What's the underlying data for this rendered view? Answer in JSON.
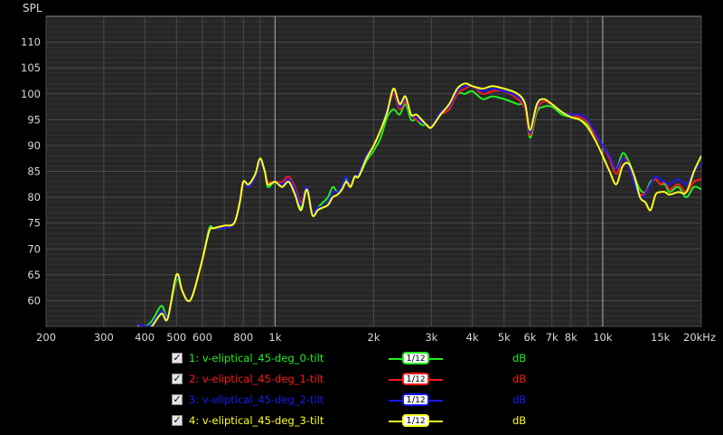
{
  "chart_data": {
    "type": "line",
    "ylabel": "SPL",
    "xscale": "log",
    "xlim": [
      200,
      20000
    ],
    "ylim": [
      55,
      115
    ],
    "grid": true,
    "xticks": [
      200,
      300,
      400,
      500,
      600,
      800,
      1000,
      2000,
      3000,
      4000,
      5000,
      6000,
      7000,
      8000,
      10000,
      15000,
      20000
    ],
    "xtick_labels": [
      "200",
      "300",
      "400",
      "500",
      "600",
      "800",
      "1k",
      "2k",
      "3k",
      "4k",
      "5k",
      "6k",
      "7k",
      "8k",
      "10k",
      "15k",
      "20kHz"
    ],
    "yticks": [
      60,
      65,
      70,
      75,
      80,
      85,
      90,
      95,
      100,
      105,
      110
    ],
    "x": [
      380,
      400,
      420,
      450,
      470,
      500,
      520,
      540,
      560,
      600,
      630,
      650,
      700,
      750,
      780,
      800,
      830,
      870,
      900,
      930,
      950,
      1000,
      1050,
      1100,
      1150,
      1200,
      1250,
      1300,
      1350,
      1400,
      1450,
      1500,
      1550,
      1600,
      1650,
      1700,
      1750,
      1800,
      1900,
      2000,
      2100,
      2200,
      2300,
      2400,
      2500,
      2600,
      2700,
      2800,
      2900,
      3000,
      3200,
      3400,
      3600,
      3800,
      4000,
      4300,
      4600,
      5000,
      5500,
      5800,
      6000,
      6300,
      6600,
      7000,
      7500,
      8000,
      8500,
      9000,
      9500,
      10000,
      10500,
      11000,
      11500,
      12000,
      12500,
      13000,
      13500,
      14000,
      14500,
      15000,
      15500,
      16000,
      17000,
      18000,
      19000,
      20000
    ],
    "series": [
      {
        "name": "1: v-eliptical_45-deg_0-tilt",
        "color": "#22ee22",
        "values": [
          55.5,
          55,
          56,
          59,
          57,
          64,
          62,
          60,
          61,
          68,
          74,
          74,
          74,
          75,
          79,
          83,
          82,
          84,
          87,
          85,
          82,
          83,
          82,
          83,
          81,
          78,
          82,
          77,
          78,
          79,
          80,
          82,
          81,
          82,
          83.5,
          82,
          84,
          84,
          87,
          89,
          91.5,
          95.5,
          97,
          96,
          98,
          95,
          95,
          94,
          94,
          93.5,
          96,
          97,
          100,
          100,
          100.5,
          99,
          99.5,
          99,
          98,
          97.5,
          91.5,
          96.5,
          97.5,
          97.5,
          96,
          95.5,
          95,
          94,
          92,
          90,
          88,
          85.5,
          88.5,
          87,
          84,
          81.5,
          81,
          83,
          83.5,
          82.5,
          82.5,
          81,
          82,
          80,
          82,
          81.5
        ]
      },
      {
        "name": "2: v-eliptical_45-deg_1-tilt",
        "color": "#ff1a1a",
        "values": [
          55.5,
          55,
          55.5,
          58,
          57,
          64.5,
          62,
          60,
          61,
          68,
          73.5,
          74,
          74,
          75,
          79,
          83,
          82,
          84,
          87,
          85,
          83,
          83,
          83,
          84,
          82,
          79,
          82,
          77,
          78,
          78,
          79,
          81,
          81,
          82,
          84,
          82,
          84,
          84.5,
          88,
          90,
          93,
          97,
          100,
          97,
          98.5,
          96,
          95,
          94.5,
          94,
          93.5,
          96,
          97,
          100,
          101,
          101.5,
          100,
          100.5,
          100.5,
          99,
          97,
          92,
          97,
          98.5,
          98,
          96.5,
          96,
          95.5,
          94.5,
          92,
          90,
          87.5,
          84.5,
          87.5,
          86.5,
          83,
          80.5,
          81,
          82.5,
          83.5,
          82.5,
          83,
          81.5,
          82.5,
          81,
          83,
          83.5
        ]
      },
      {
        "name": "3: v-eliptical_45-deg_2-tilt",
        "color": "#1a1aee",
        "values": [
          55.5,
          55,
          55.5,
          58,
          57,
          64.5,
          62,
          60,
          61,
          68,
          73.5,
          74,
          74,
          75,
          79,
          83,
          82,
          84,
          87,
          85,
          82.5,
          83,
          82.5,
          83.5,
          81.5,
          78.5,
          82,
          77,
          78,
          78,
          79,
          81,
          81,
          82,
          84,
          82,
          84,
          84.5,
          88,
          90,
          93,
          97,
          100.5,
          97.5,
          99,
          96,
          95.5,
          94.5,
          94,
          93.5,
          96.5,
          97.5,
          100.5,
          101.5,
          101.5,
          100.5,
          101,
          100.5,
          99.5,
          97.5,
          92.5,
          97.5,
          99,
          98,
          96.5,
          96,
          96,
          95,
          92.5,
          90,
          88,
          85.5,
          87.5,
          86,
          82.5,
          80,
          80.5,
          82.5,
          84,
          83.5,
          83,
          82.5,
          83.5,
          82.5,
          85,
          86.5
        ]
      },
      {
        "name": "4: v-eliptical_45-deg_3-tilt",
        "color": "#ffff22",
        "values": [
          55,
          54.5,
          55,
          57.5,
          56.5,
          65,
          62,
          60,
          61,
          68,
          73.5,
          74,
          74.5,
          75,
          79,
          83,
          82.5,
          84.5,
          87.5,
          85,
          82.5,
          83,
          82,
          83,
          80.5,
          77.5,
          81.5,
          76.5,
          77.5,
          78,
          78.5,
          80,
          80.5,
          81.5,
          83,
          82,
          84,
          84,
          87.5,
          90,
          93,
          96.5,
          101,
          98,
          99.5,
          96,
          96,
          95,
          94,
          93.5,
          96,
          98,
          101,
          102,
          101.5,
          101,
          101.5,
          101,
          100,
          98,
          93,
          98,
          99,
          98,
          96.5,
          95.5,
          95,
          93.5,
          91,
          88,
          85,
          82.5,
          86,
          86.5,
          84,
          80,
          79,
          77.5,
          80.5,
          81,
          81,
          80.5,
          81,
          81,
          85,
          88
        ]
      }
    ],
    "legend": [
      {
        "label": "1: v-eliptical_45-deg_0-tilt",
        "smoothing_num": "1",
        "smoothing_den": "12",
        "unit": "dB",
        "color": "#22ee22",
        "checked": true
      },
      {
        "label": "2: v-eliptical_45-deg_1-tilt",
        "smoothing_num": "1",
        "smoothing_den": "12",
        "unit": "dB",
        "color": "#ff1a1a",
        "checked": true
      },
      {
        "label": "3: v-eliptical_45-deg_2-tilt",
        "smoothing_num": "1",
        "smoothing_den": "12",
        "unit": "dB",
        "color": "#1a1aee",
        "checked": true
      },
      {
        "label": "4: v-eliptical_45-deg_3-tilt",
        "smoothing_num": "1",
        "smoothing_den": "12",
        "unit": "dB",
        "color": "#ffff22",
        "checked": true
      }
    ],
    "colors": {
      "background": "#000000",
      "plot_background": "#262626",
      "grid": "#4a4a4a",
      "grid_highlight": "#9a9a9a",
      "text": "#d8d8d8"
    }
  }
}
